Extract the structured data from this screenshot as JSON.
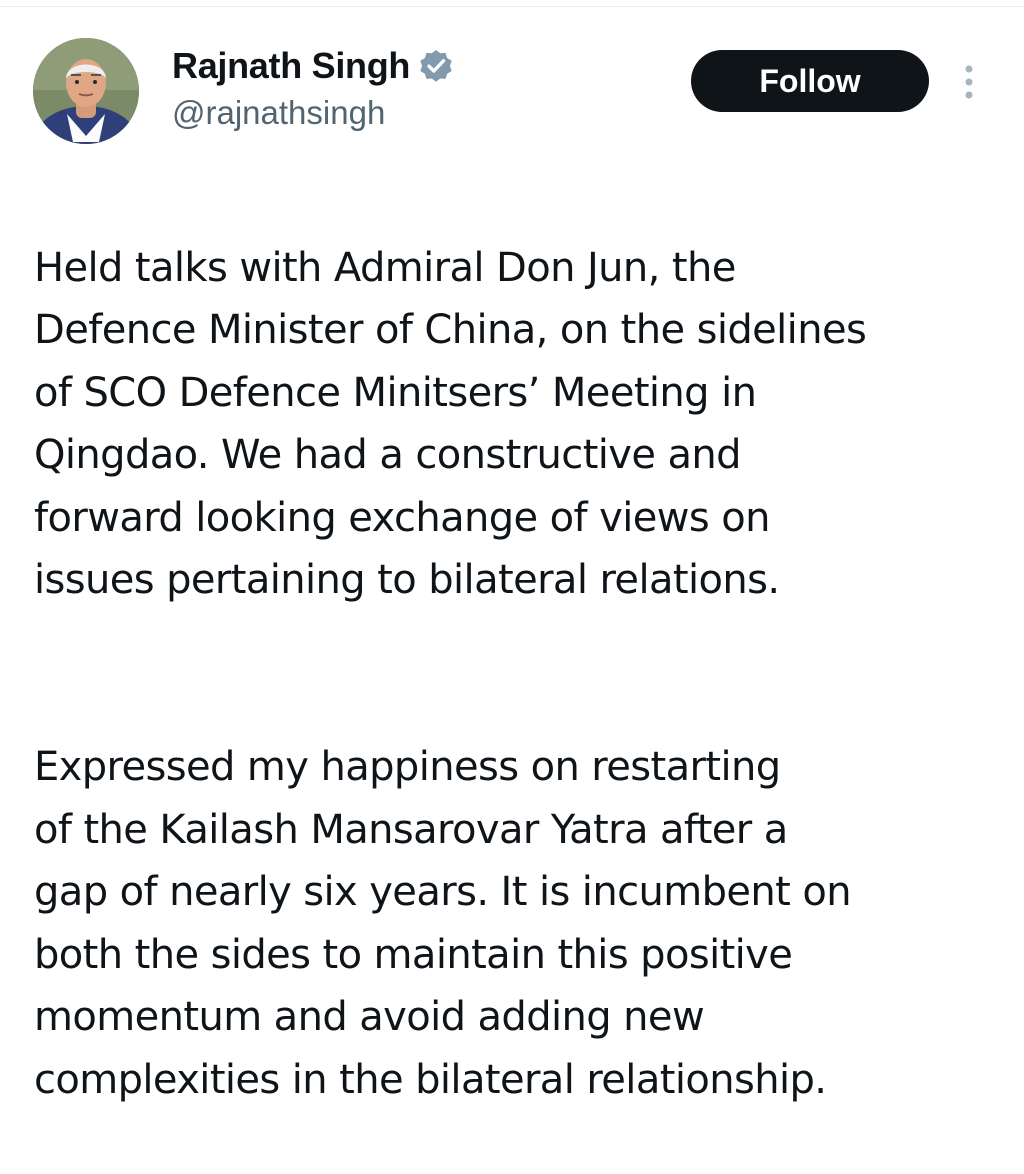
{
  "author": {
    "display_name": "Rajnath Singh",
    "handle": "@rajnathsingh",
    "verified_icon": "verified-badge-icon",
    "avatar_icon": "profile-photo"
  },
  "actions": {
    "follow_label": "Follow",
    "more_icon": "more-vertical-icon"
  },
  "post": {
    "paragraphs": [
      "Held talks with Admiral Don Jun, the\nDefence Minister of China, on the sidelines\nof SCO Defence Minitsers’ Meeting in\nQingdao. We had a constructive and\nforward looking exchange of views on\nissues pertaining to bilateral relations.",
      "Expressed my happiness on restarting\nof the Kailash Mansarovar Yatra after a\ngap of nearly six years. It is incumbent on\nboth the sides to maintain this positive\nmomentum and avoid adding new\ncomplexities in the bilateral relationship."
    ]
  },
  "colors": {
    "text_primary": "#0f1419",
    "text_secondary": "#536471",
    "follow_button_bg": "#0f1419",
    "verified_badge": "#829aab"
  }
}
